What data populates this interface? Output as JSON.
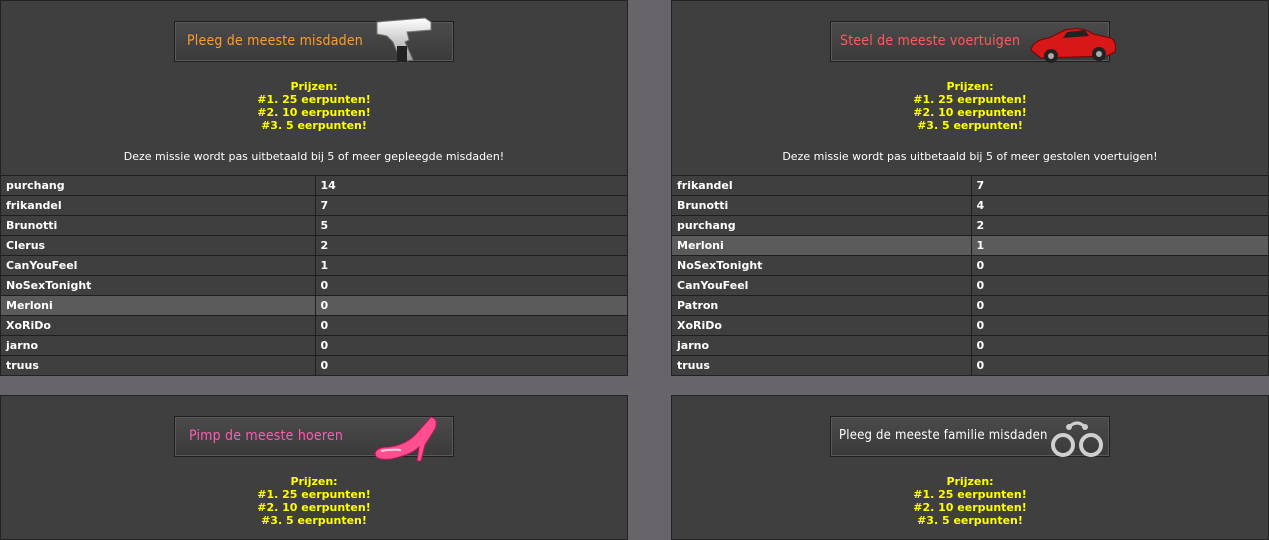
{
  "panels": [
    {
      "banner": "Pleeg de meeste misdaden",
      "banner_color": "#ff9c2a",
      "icon": "pistol-icon",
      "prizes": [
        "Prijzen:",
        "#1. 25 eerpunten!",
        "#2. 10 eerpunten!",
        "#3. 5 eerpunten!"
      ],
      "note": "Deze missie wordt pas uitbetaald bij 5 of meer gepleegde misdaden!",
      "highlight_row": 6,
      "rows": [
        {
          "name": "purchang",
          "score": "14"
        },
        {
          "name": "frikandel",
          "score": "7"
        },
        {
          "name": "Brunotti",
          "score": "5"
        },
        {
          "name": "Clerus",
          "score": "2"
        },
        {
          "name": "CanYouFeel",
          "score": "1"
        },
        {
          "name": "NoSexTonight",
          "score": "0"
        },
        {
          "name": "Merloni",
          "score": "0"
        },
        {
          "name": "XoRiDo",
          "score": "0"
        },
        {
          "name": "jarno",
          "score": "0"
        },
        {
          "name": "truus",
          "score": "0"
        }
      ]
    },
    {
      "banner": "Steel de meeste voertuigen",
      "banner_color": "#ff5a5a",
      "icon": "red-car-icon",
      "prizes": [
        "Prijzen:",
        "#1. 25 eerpunten!",
        "#2. 10 eerpunten!",
        "#3. 5 eerpunten!"
      ],
      "note": "Deze missie wordt pas uitbetaald bij 5 of meer gestolen voertuigen!",
      "highlight_row": 3,
      "rows": [
        {
          "name": "frikandel",
          "score": "7"
        },
        {
          "name": "Brunotti",
          "score": "4"
        },
        {
          "name": "purchang",
          "score": "2"
        },
        {
          "name": "Merloni",
          "score": "1"
        },
        {
          "name": "NoSexTonight",
          "score": "0"
        },
        {
          "name": "CanYouFeel",
          "score": "0"
        },
        {
          "name": "Patron",
          "score": "0"
        },
        {
          "name": "XoRiDo",
          "score": "0"
        },
        {
          "name": "jarno",
          "score": "0"
        },
        {
          "name": "truus",
          "score": "0"
        }
      ]
    },
    {
      "banner": "Pimp de meeste hoeren",
      "banner_color": "#ff5ab4",
      "icon": "high-heel-icon",
      "prizes": [
        "Prijzen:",
        "#1. 25 eerpunten!",
        "#2. 10 eerpunten!",
        "#3. 5 eerpunten!"
      ]
    },
    {
      "banner": "Pleeg de meeste familie misdaden",
      "banner_color": "#ffffff",
      "icon": "handcuffs-icon",
      "prizes": [
        "Prijzen:",
        "#1. 25 eerpunten!",
        "#2. 10 eerpunten!",
        "#3. 5 eerpunten!"
      ]
    }
  ]
}
